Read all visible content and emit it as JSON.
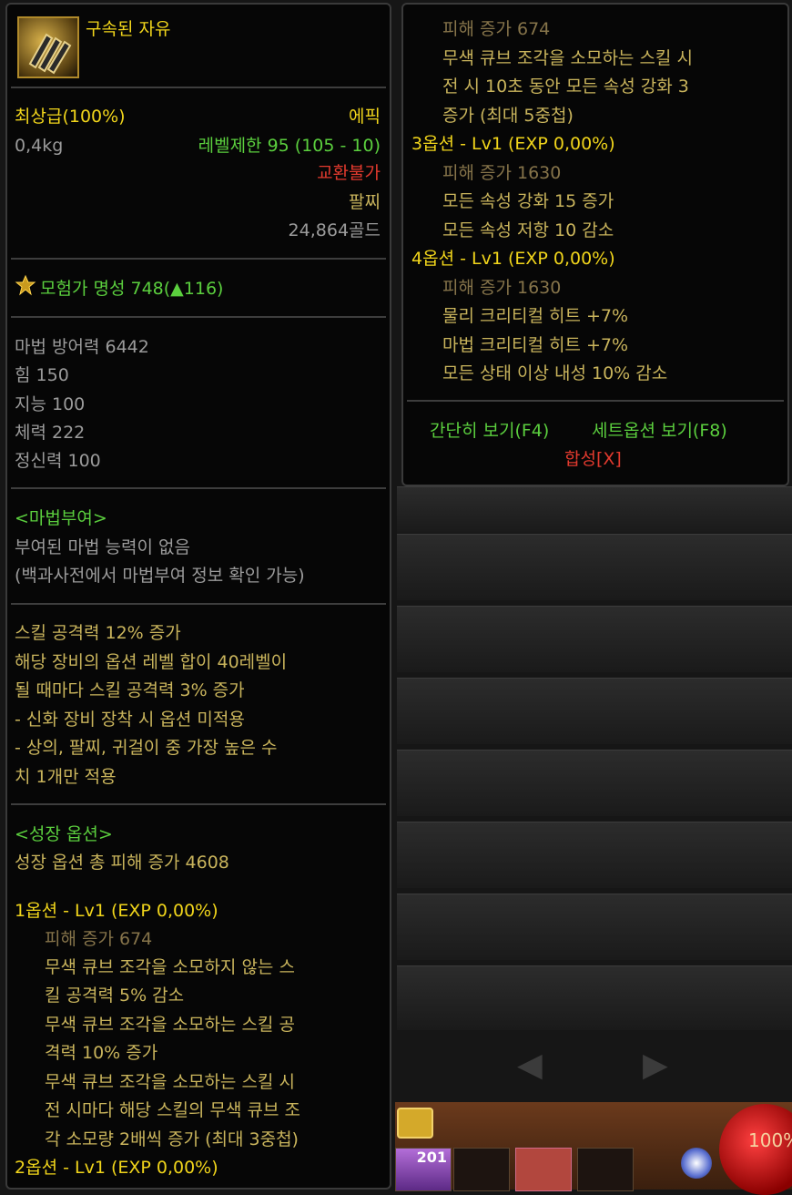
{
  "item": {
    "name": "구속된 자유",
    "icon": "bracelet-claw-icon",
    "grade": "최상급(100%)",
    "rarity": "에픽",
    "weight": "0,4kg",
    "level_limit": "레벨제한 95 (105 - 10)",
    "trade": "교환불가",
    "slot_type": "팔찌",
    "price": "24,864골드",
    "reputation": "모험가 명성 748(",
    "reputation_delta": "▲116)"
  },
  "stats": [
    "마법 방어력 6442",
    "힘 150",
    "지능 100",
    "체력 222",
    "정신력 100"
  ],
  "enchant": {
    "title": "<마법부여>",
    "lines": [
      "부여된 마법 능력이 없음",
      "(백과사전에서 마법부여 정보 확인 가능)"
    ]
  },
  "effects": [
    "스킬 공격력 12% 증가",
    "해당 장비의 옵션 레벨 합이 40레벨이",
    "될 때마다 스킬 공격력 3% 증가",
    "- 신화 장비 장착 시 옵션 미적용",
    "- 상의, 팔찌, 귀걸이 중 가장 높은 수",
    "치 1개만 적용"
  ],
  "growth": {
    "title": "<성장 옵션>",
    "total": "성장 옵션 총 피해 증가 4608",
    "opt1_header": "1옵션 - Lv1 (EXP 0,00%)",
    "opt1_lines": [
      "피해 증가 674",
      "무색 큐브 조각을 소모하지 않는 스",
      "킬 공격력 5% 감소",
      "무색 큐브 조각을 소모하는 스킬 공",
      "격력 10% 증가",
      "무색 큐브 조각을 소모하는 스킬 시",
      "전 시마다 해당 스킬의 무색 큐브 조",
      "각 소모량 2배씩 증가 (최대 3중첩)"
    ],
    "opt2_header": "2옵션 - Lv1 (EXP 0,00%)",
    "opt2_lines": [
      "피해 증가 674",
      "무색 큐브 조각을 소모하는 스킬 시",
      "전 시 10초 동안 모든 속성 강화 3",
      "증가 (최대 5중첩)"
    ],
    "opt3_header": "3옵션 - Lv1 (EXP 0,00%)",
    "opt3_lines": [
      "피해 증가 1630",
      "모든 속성 강화 15 증가",
      "모든 속성 저항 10 감소"
    ],
    "opt4_header": "4옵션 - Lv1 (EXP 0,00%)",
    "opt4_lines": [
      "피해 증가 1630",
      "물리 크리티컬 히트 +7%",
      "마법 크리티컬 히트 +7%",
      "모든 상태 이상 내성 10% 감소"
    ]
  },
  "footer": {
    "simple_view": "간단히 보기(F4)",
    "set_view": "세트옵션 보기(F8)",
    "synthesis": "합성[X]"
  },
  "hud": {
    "count": "201",
    "hp_percent": "100%",
    "pager_prev": "◀",
    "pager_next": "▶"
  },
  "colors": {
    "grade": "#f1d51b",
    "epic": "#f1d51b",
    "level_ok": "#5bcf3e",
    "untradable": "#e23a2e",
    "body_text": "#c9b45c"
  }
}
